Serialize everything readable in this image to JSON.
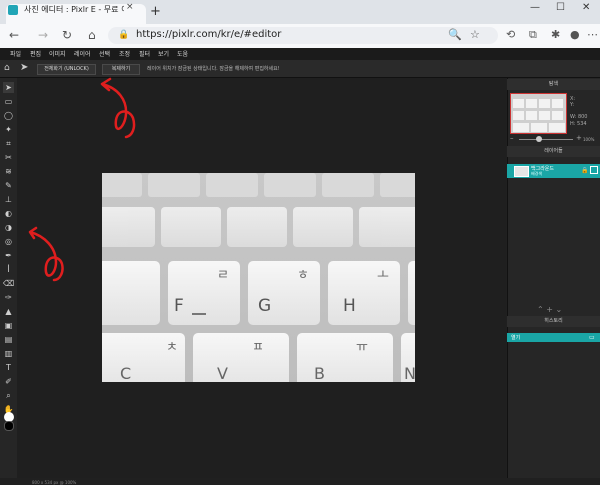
{
  "browser": {
    "tab_title": "사진 에디터 : Pixlr E - 무료 이미지",
    "close": "×",
    "new_tab": "+",
    "window_controls": [
      "—",
      "☐",
      "✕"
    ],
    "nav": {
      "back": "←",
      "forward": "→",
      "refresh": "↻",
      "home": "⌂"
    },
    "lock": "🔒",
    "url": "https://pixlr.com/kr/e/#editor",
    "toolbar_icons": [
      "🔍",
      "☆",
      "⟲",
      "⧉",
      "✱",
      "●",
      "⋯"
    ]
  },
  "app": {
    "menu": [
      "파일",
      "편집",
      "이미지",
      "레이어",
      "선택",
      "조정",
      "필터",
      "보기",
      "도움"
    ],
    "option_bar": {
      "home": "⌂",
      "pointer": "➤",
      "unlock_button": "전체화기 (UNLOCK)",
      "second_button": "복제하기",
      "hint": "레이어 위치가 잠금된 상태입니다. 잠금을 해제하여 편집하세요!"
    },
    "tools": [
      "➤",
      "▭",
      "◯",
      "✦",
      "⌗",
      "✂",
      "≋",
      "✎",
      "⊥",
      "◐",
      "◑",
      "◎",
      "✒",
      "ꟾ",
      "⌫",
      "✑",
      "▲",
      "▣",
      "▤",
      "▥",
      "T",
      "✐",
      "⌕",
      "✋"
    ],
    "status": "800 x 534 px @ 100%",
    "photo": {
      "keys_row1": [
        "",
        "",
        "",
        "",
        ""
      ],
      "keys_row2": [
        "ㄹ",
        "ㅎ",
        "ㅗ"
      ],
      "keys_row3": [
        "F",
        "G",
        "H"
      ],
      "keys_row4": [
        "ㅊ",
        "ㅍ",
        "ㅠ"
      ],
      "keys_row5": [
        "C",
        "V",
        "B",
        "N"
      ]
    },
    "panel": {
      "navigator_title": "탐색",
      "nav_x": "X:",
      "nav_y": "Y:",
      "nav_w_label": "W:",
      "nav_w": "800",
      "nav_h_label": "H:",
      "nav_h": "534",
      "zoom": "100%",
      "zoom_minus": "–",
      "zoom_plus": "+",
      "layers_title": "레이어들",
      "layer_name": "백그라운드",
      "layer_sub": "배경색",
      "layer_lock": "🔒",
      "layer_actions": "⌃ + ⌄",
      "history_title": "히스토리",
      "history_item": "열기",
      "history_icon": "▭"
    }
  },
  "colors": {
    "accent": "#1aa6a6",
    "annotation": "#e01e1e",
    "workspace": "#1f1f1f"
  }
}
